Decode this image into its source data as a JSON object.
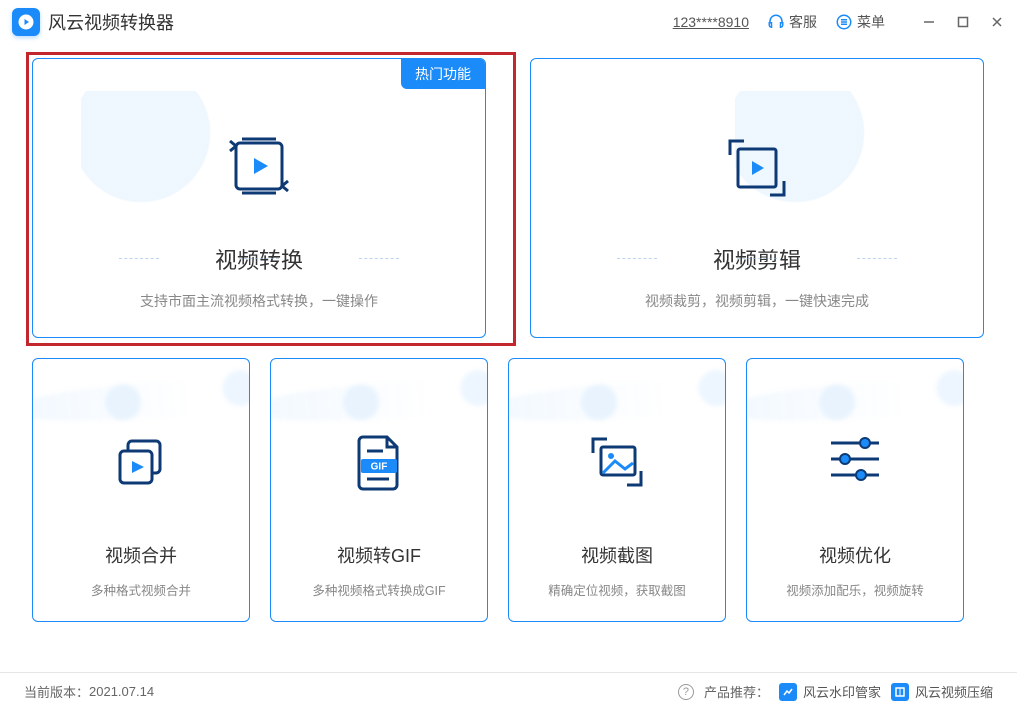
{
  "app": {
    "title": "风云视频转换器"
  },
  "titlebar": {
    "account": "123****8910",
    "service_label": "客服",
    "menu_label": "菜单"
  },
  "cards": {
    "convert": {
      "badge": "热门功能",
      "title": "视频转换",
      "desc": "支持市面主流视频格式转换，一键操作"
    },
    "clip": {
      "title": "视频剪辑",
      "desc": "视频裁剪，视频剪辑，一键快速完成"
    },
    "merge": {
      "title": "视频合并",
      "desc": "多种格式视频合并"
    },
    "gif": {
      "title": "视频转GIF",
      "desc": "多种视频格式转换成GIF",
      "tag": "GIF"
    },
    "screenshot": {
      "title": "视频截图",
      "desc": "精确定位视频，获取截图"
    },
    "optimize": {
      "title": "视频优化",
      "desc": "视频添加配乐，视频旋转"
    }
  },
  "footer": {
    "version_label": "当前版本：",
    "version": "2021.07.14",
    "recommend_label": "产品推荐：",
    "rec1": "风云水印管家",
    "rec2": "风云视频压缩"
  }
}
